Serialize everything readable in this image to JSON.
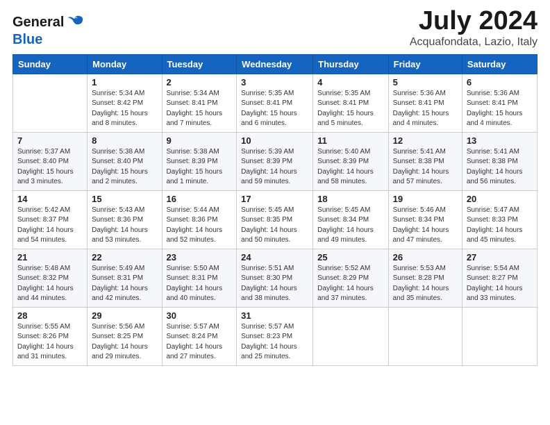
{
  "logo": {
    "general": "General",
    "blue": "Blue"
  },
  "header": {
    "month_title": "July 2024",
    "location": "Acquafondata, Lazio, Italy"
  },
  "days_of_week": [
    "Sunday",
    "Monday",
    "Tuesday",
    "Wednesday",
    "Thursday",
    "Friday",
    "Saturday"
  ],
  "weeks": [
    [
      {
        "day": "",
        "info": ""
      },
      {
        "day": "1",
        "info": "Sunrise: 5:34 AM\nSunset: 8:42 PM\nDaylight: 15 hours\nand 8 minutes."
      },
      {
        "day": "2",
        "info": "Sunrise: 5:34 AM\nSunset: 8:41 PM\nDaylight: 15 hours\nand 7 minutes."
      },
      {
        "day": "3",
        "info": "Sunrise: 5:35 AM\nSunset: 8:41 PM\nDaylight: 15 hours\nand 6 minutes."
      },
      {
        "day": "4",
        "info": "Sunrise: 5:35 AM\nSunset: 8:41 PM\nDaylight: 15 hours\nand 5 minutes."
      },
      {
        "day": "5",
        "info": "Sunrise: 5:36 AM\nSunset: 8:41 PM\nDaylight: 15 hours\nand 4 minutes."
      },
      {
        "day": "6",
        "info": "Sunrise: 5:36 AM\nSunset: 8:41 PM\nDaylight: 15 hours\nand 4 minutes."
      }
    ],
    [
      {
        "day": "7",
        "info": "Sunrise: 5:37 AM\nSunset: 8:40 PM\nDaylight: 15 hours\nand 3 minutes."
      },
      {
        "day": "8",
        "info": "Sunrise: 5:38 AM\nSunset: 8:40 PM\nDaylight: 15 hours\nand 2 minutes."
      },
      {
        "day": "9",
        "info": "Sunrise: 5:38 AM\nSunset: 8:39 PM\nDaylight: 15 hours\nand 1 minute."
      },
      {
        "day": "10",
        "info": "Sunrise: 5:39 AM\nSunset: 8:39 PM\nDaylight: 14 hours\nand 59 minutes."
      },
      {
        "day": "11",
        "info": "Sunrise: 5:40 AM\nSunset: 8:39 PM\nDaylight: 14 hours\nand 58 minutes."
      },
      {
        "day": "12",
        "info": "Sunrise: 5:41 AM\nSunset: 8:38 PM\nDaylight: 14 hours\nand 57 minutes."
      },
      {
        "day": "13",
        "info": "Sunrise: 5:41 AM\nSunset: 8:38 PM\nDaylight: 14 hours\nand 56 minutes."
      }
    ],
    [
      {
        "day": "14",
        "info": "Sunrise: 5:42 AM\nSunset: 8:37 PM\nDaylight: 14 hours\nand 54 minutes."
      },
      {
        "day": "15",
        "info": "Sunrise: 5:43 AM\nSunset: 8:36 PM\nDaylight: 14 hours\nand 53 minutes."
      },
      {
        "day": "16",
        "info": "Sunrise: 5:44 AM\nSunset: 8:36 PM\nDaylight: 14 hours\nand 52 minutes."
      },
      {
        "day": "17",
        "info": "Sunrise: 5:45 AM\nSunset: 8:35 PM\nDaylight: 14 hours\nand 50 minutes."
      },
      {
        "day": "18",
        "info": "Sunrise: 5:45 AM\nSunset: 8:34 PM\nDaylight: 14 hours\nand 49 minutes."
      },
      {
        "day": "19",
        "info": "Sunrise: 5:46 AM\nSunset: 8:34 PM\nDaylight: 14 hours\nand 47 minutes."
      },
      {
        "day": "20",
        "info": "Sunrise: 5:47 AM\nSunset: 8:33 PM\nDaylight: 14 hours\nand 45 minutes."
      }
    ],
    [
      {
        "day": "21",
        "info": "Sunrise: 5:48 AM\nSunset: 8:32 PM\nDaylight: 14 hours\nand 44 minutes."
      },
      {
        "day": "22",
        "info": "Sunrise: 5:49 AM\nSunset: 8:31 PM\nDaylight: 14 hours\nand 42 minutes."
      },
      {
        "day": "23",
        "info": "Sunrise: 5:50 AM\nSunset: 8:31 PM\nDaylight: 14 hours\nand 40 minutes."
      },
      {
        "day": "24",
        "info": "Sunrise: 5:51 AM\nSunset: 8:30 PM\nDaylight: 14 hours\nand 38 minutes."
      },
      {
        "day": "25",
        "info": "Sunrise: 5:52 AM\nSunset: 8:29 PM\nDaylight: 14 hours\nand 37 minutes."
      },
      {
        "day": "26",
        "info": "Sunrise: 5:53 AM\nSunset: 8:28 PM\nDaylight: 14 hours\nand 35 minutes."
      },
      {
        "day": "27",
        "info": "Sunrise: 5:54 AM\nSunset: 8:27 PM\nDaylight: 14 hours\nand 33 minutes."
      }
    ],
    [
      {
        "day": "28",
        "info": "Sunrise: 5:55 AM\nSunset: 8:26 PM\nDaylight: 14 hours\nand 31 minutes."
      },
      {
        "day": "29",
        "info": "Sunrise: 5:56 AM\nSunset: 8:25 PM\nDaylight: 14 hours\nand 29 minutes."
      },
      {
        "day": "30",
        "info": "Sunrise: 5:57 AM\nSunset: 8:24 PM\nDaylight: 14 hours\nand 27 minutes."
      },
      {
        "day": "31",
        "info": "Sunrise: 5:57 AM\nSunset: 8:23 PM\nDaylight: 14 hours\nand 25 minutes."
      },
      {
        "day": "",
        "info": ""
      },
      {
        "day": "",
        "info": ""
      },
      {
        "day": "",
        "info": ""
      }
    ]
  ]
}
